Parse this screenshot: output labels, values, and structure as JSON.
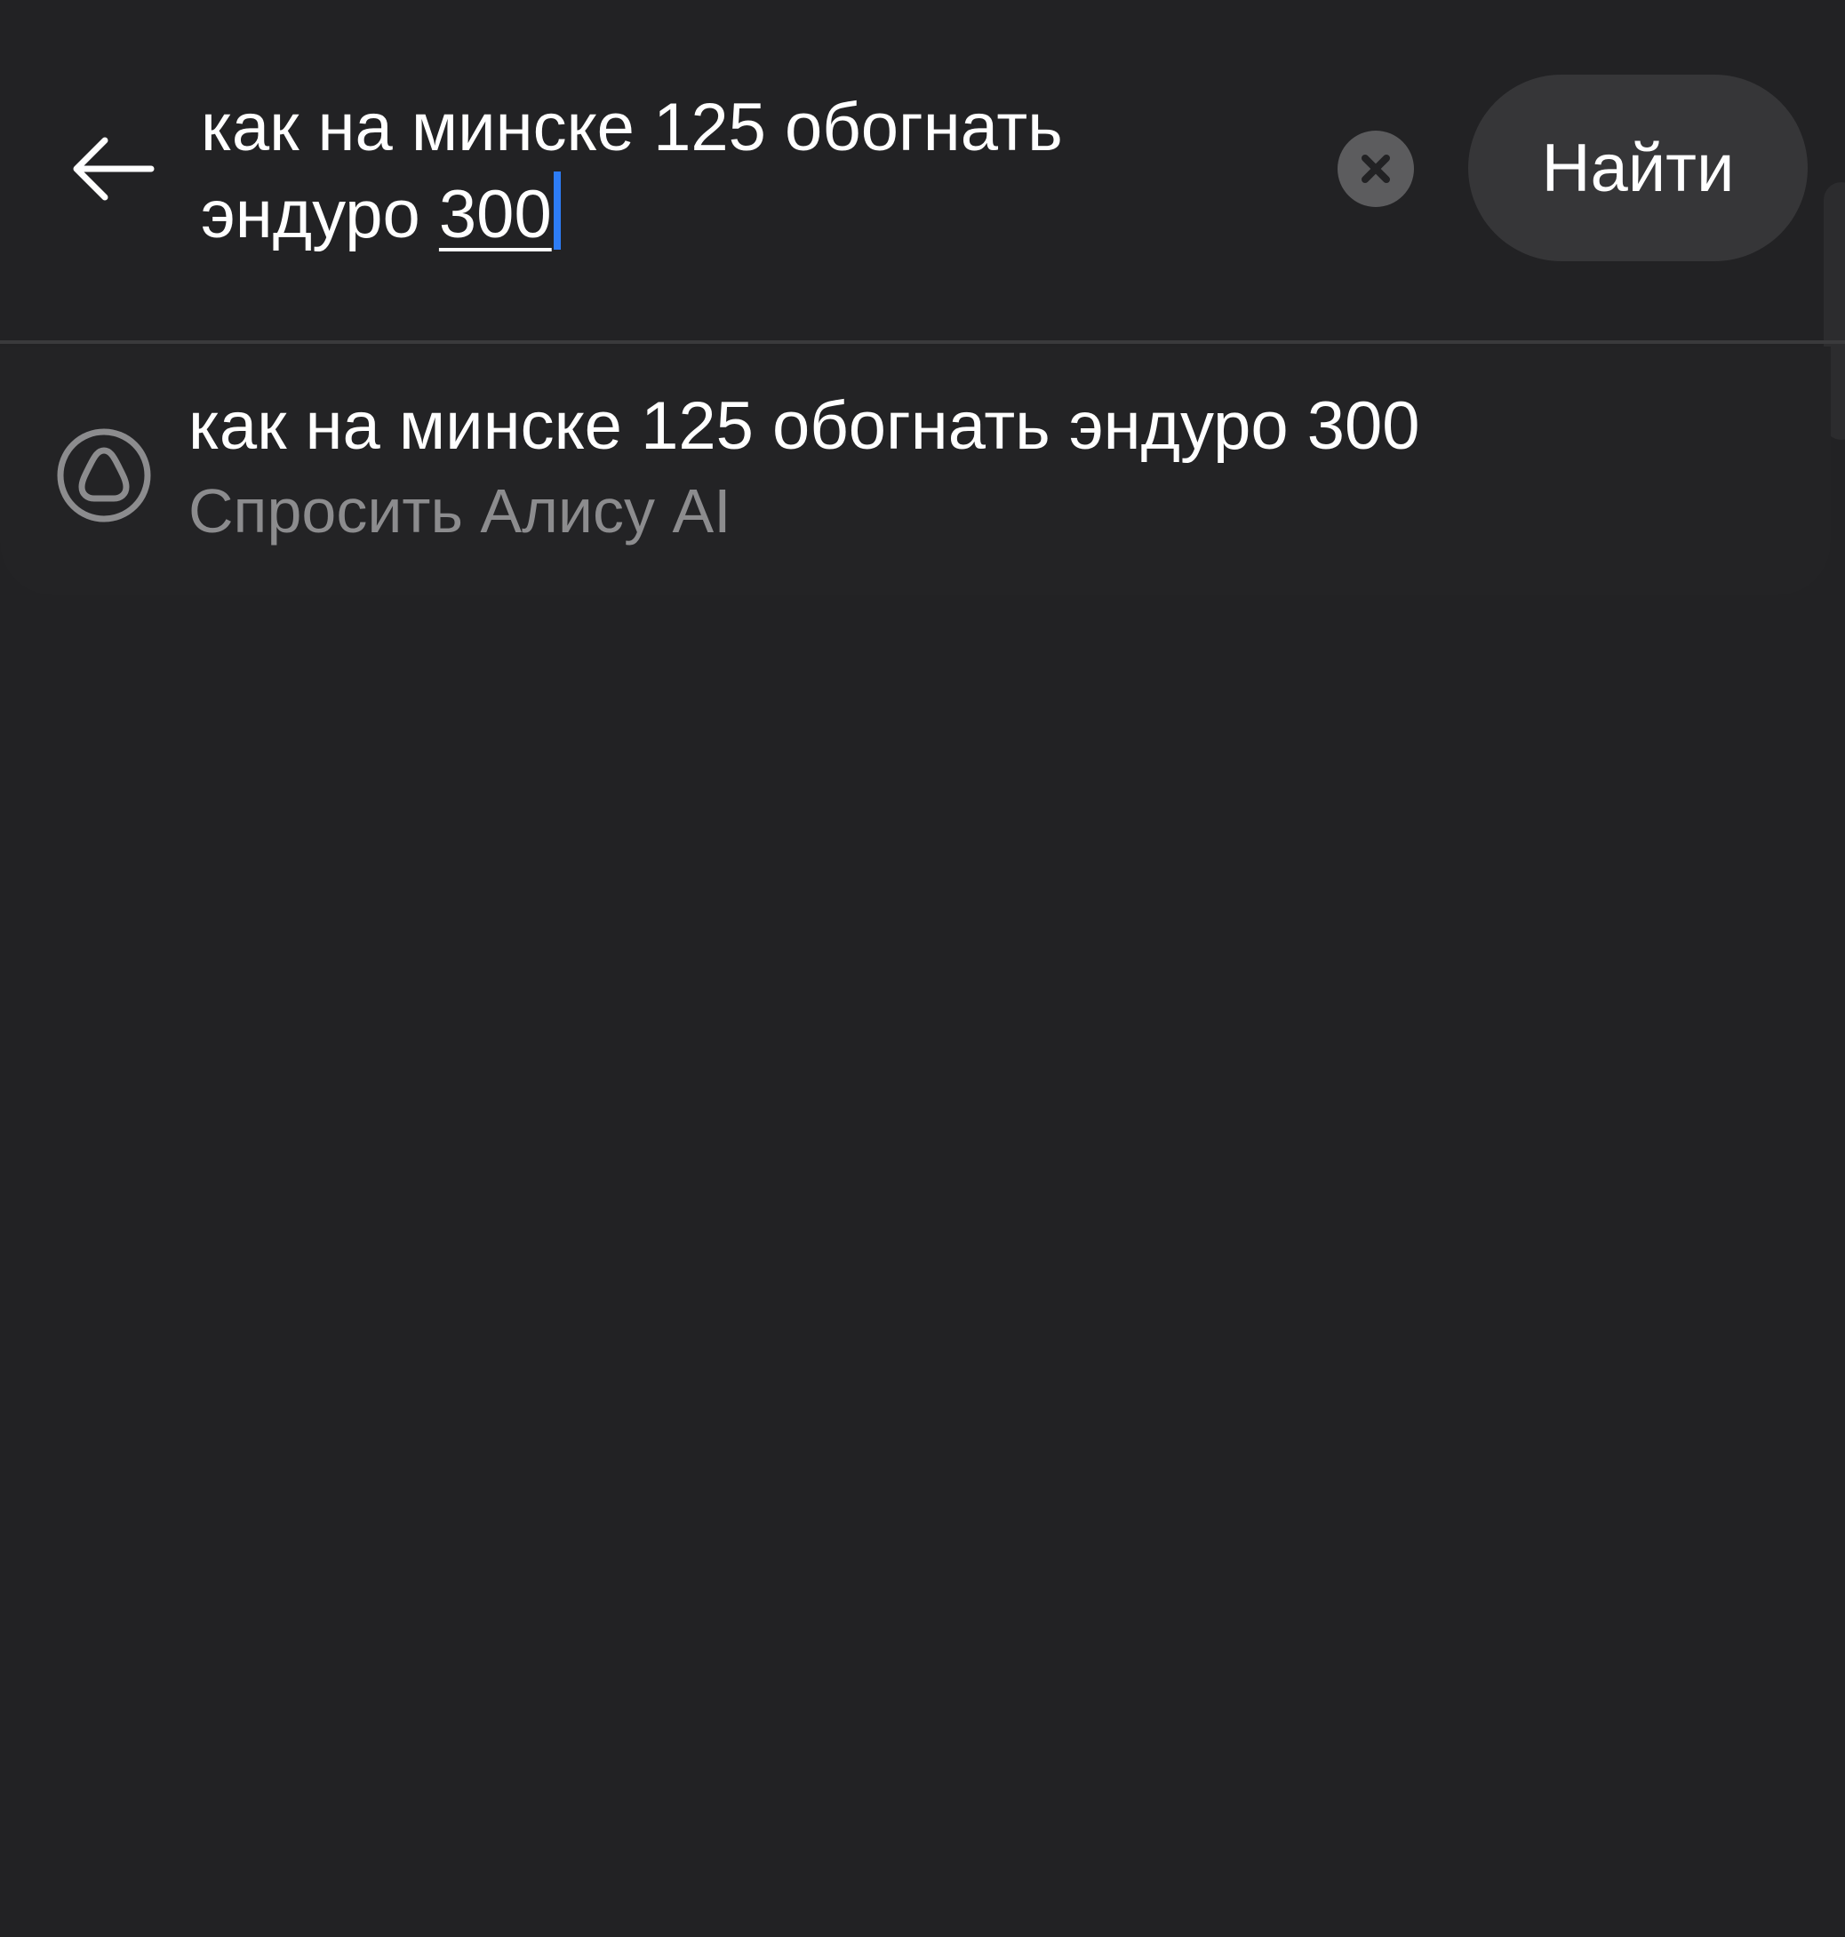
{
  "search": {
    "query_line1": "как на минске 125 обогнать",
    "query_line2_prefix": "эндуро ",
    "query_line2_underlined": "300",
    "find_label": "Найти"
  },
  "suggestions": [
    {
      "title": "как на минске 125 обогнать эндуро 300",
      "subtitle": "Спросить Алису AI",
      "icon": "alice-icon"
    }
  ],
  "colors": {
    "background": "#222224",
    "caret": "#2d7cf6",
    "subtitle": "#8c8c8e",
    "button": "#363638"
  }
}
